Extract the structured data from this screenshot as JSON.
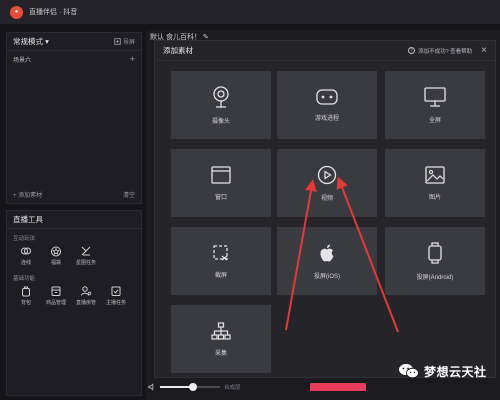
{
  "app": {
    "title": "直播伴侣 · 抖音"
  },
  "scenes": {
    "mode": "常规模式 ▾",
    "import_label": "导屏",
    "scene_name": "场景六",
    "add_material": "+ 添加素材",
    "clear": "清空"
  },
  "tools": {
    "title": "直播工具",
    "group_interaction": "互动玩法",
    "interaction_items": [
      {
        "label": "连线",
        "icon": "link-icon"
      },
      {
        "label": "福袋",
        "icon": "lucky-bag-icon"
      },
      {
        "label": "星图任务",
        "icon": "star-task-icon"
      }
    ],
    "group_basic": "基础功能",
    "basic_items": [
      {
        "label": "背包",
        "icon": "backpack-icon"
      },
      {
        "label": "商品管理",
        "icon": "shop-icon"
      },
      {
        "label": "直播房管",
        "icon": "room-admin-icon"
      },
      {
        "label": "主播任务",
        "icon": "task-icon"
      }
    ]
  },
  "center": {
    "tab": "默认 食儿百科！ ✎",
    "mic_label": "台成层"
  },
  "modal": {
    "title": "添加素材",
    "help": "添加不成功? 查看帮助",
    "close": "×",
    "tiles": [
      {
        "label": "摄像头",
        "icon": "camera-icon"
      },
      {
        "label": "游戏进程",
        "icon": "gamepad-icon"
      },
      {
        "label": "全屏",
        "icon": "monitor-icon"
      },
      {
        "label": "窗口",
        "icon": "window-icon"
      },
      {
        "label": "视频",
        "icon": "play-icon"
      },
      {
        "label": "图片",
        "icon": "image-icon"
      },
      {
        "label": "截屏",
        "icon": "crop-icon"
      },
      {
        "label": "投屏(iOS)",
        "icon": "apple-icon"
      },
      {
        "label": "投屏(Android)",
        "icon": "android-phone-icon"
      },
      {
        "label": "采集",
        "icon": "capture-tree-icon"
      }
    ]
  },
  "volume": {
    "level": 0.55
  },
  "watermark": {
    "text": "梦想云天社"
  },
  "colors": {
    "accent": "#e83d5a",
    "arrow": "#e53935",
    "tile": "#3a3a41"
  }
}
